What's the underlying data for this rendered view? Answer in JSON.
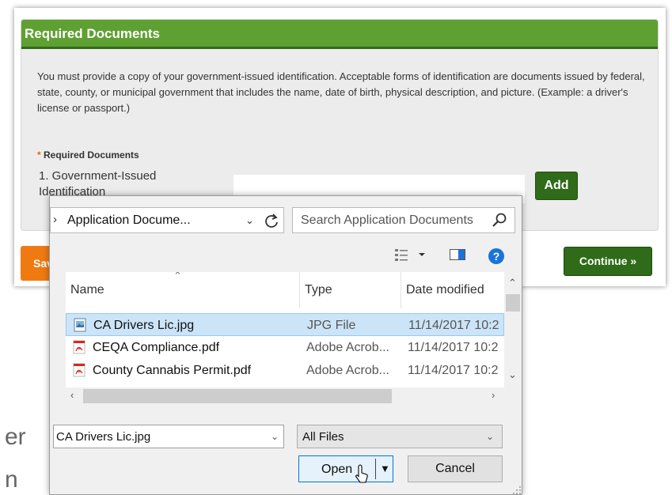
{
  "card": {
    "title": "Required Documents",
    "instructions": "You must provide a copy of your government-issued identification.  Acceptable forms of identification are documents issued by federal, state, county, or municipal government that includes the name, date of birth, physical description, and picture. (Example: a driver's license or passport.)",
    "required_label": "Required Documents",
    "required_marker": "*",
    "doc_item": "1. Government-Issued Identification",
    "add_label": "Add"
  },
  "footer": {
    "save_label": "Save",
    "continue_label": "Continue »"
  },
  "background_text": [
    "er",
    "n"
  ],
  "dialog": {
    "address": "Application Docume...",
    "search_placeholder": "Search Application Documents",
    "columns": {
      "name": "Name",
      "type": "Type",
      "date": "Date modified"
    },
    "files": [
      {
        "name": "CA Drivers Lic.jpg",
        "type": "JPG File",
        "date": "11/14/2017 10:2",
        "icon": "image-file-icon",
        "selected": true
      },
      {
        "name": "CEQA Compliance.pdf",
        "type": "Adobe Acrob...",
        "date": "11/14/2017 10:2",
        "icon": "pdf-file-icon",
        "selected": false
      },
      {
        "name": "County Cannabis Permit.pdf",
        "type": "Adobe Acrob...",
        "date": "11/14/2017 10:2",
        "icon": "pdf-file-icon",
        "selected": false
      }
    ],
    "filename_value": "CA Drivers Lic.jpg",
    "filter_value": "All Files",
    "open_label": "Open",
    "cancel_label": "Cancel"
  },
  "colors": {
    "header_green": "#5fa033",
    "button_green": "#2f6b18",
    "save_orange": "#f07a12",
    "selection_blue": "#cce4f7",
    "help_blue": "#1a73d8",
    "pdf_red": "#d8281f"
  }
}
